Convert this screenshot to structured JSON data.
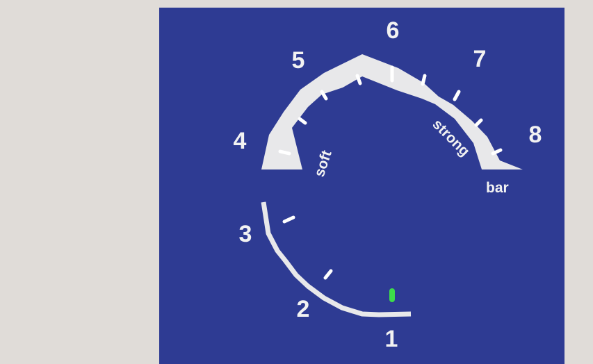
{
  "dial": {
    "upper_scale": {
      "numbers": [
        "4",
        "5",
        "6",
        "7",
        "8"
      ]
    },
    "lower_scale": {
      "numbers": [
        "1",
        "2",
        "3"
      ]
    },
    "labels": {
      "soft": "soft",
      "strong": "strong",
      "unit": "bar"
    },
    "colors": {
      "panel": "#2e3b93",
      "scale": "#e8e8ea",
      "text": "#f2f2f2",
      "indicator": "#3ddc4a",
      "background": "#e0dcd8"
    },
    "indicator": {
      "position": "1",
      "state": "on"
    }
  }
}
